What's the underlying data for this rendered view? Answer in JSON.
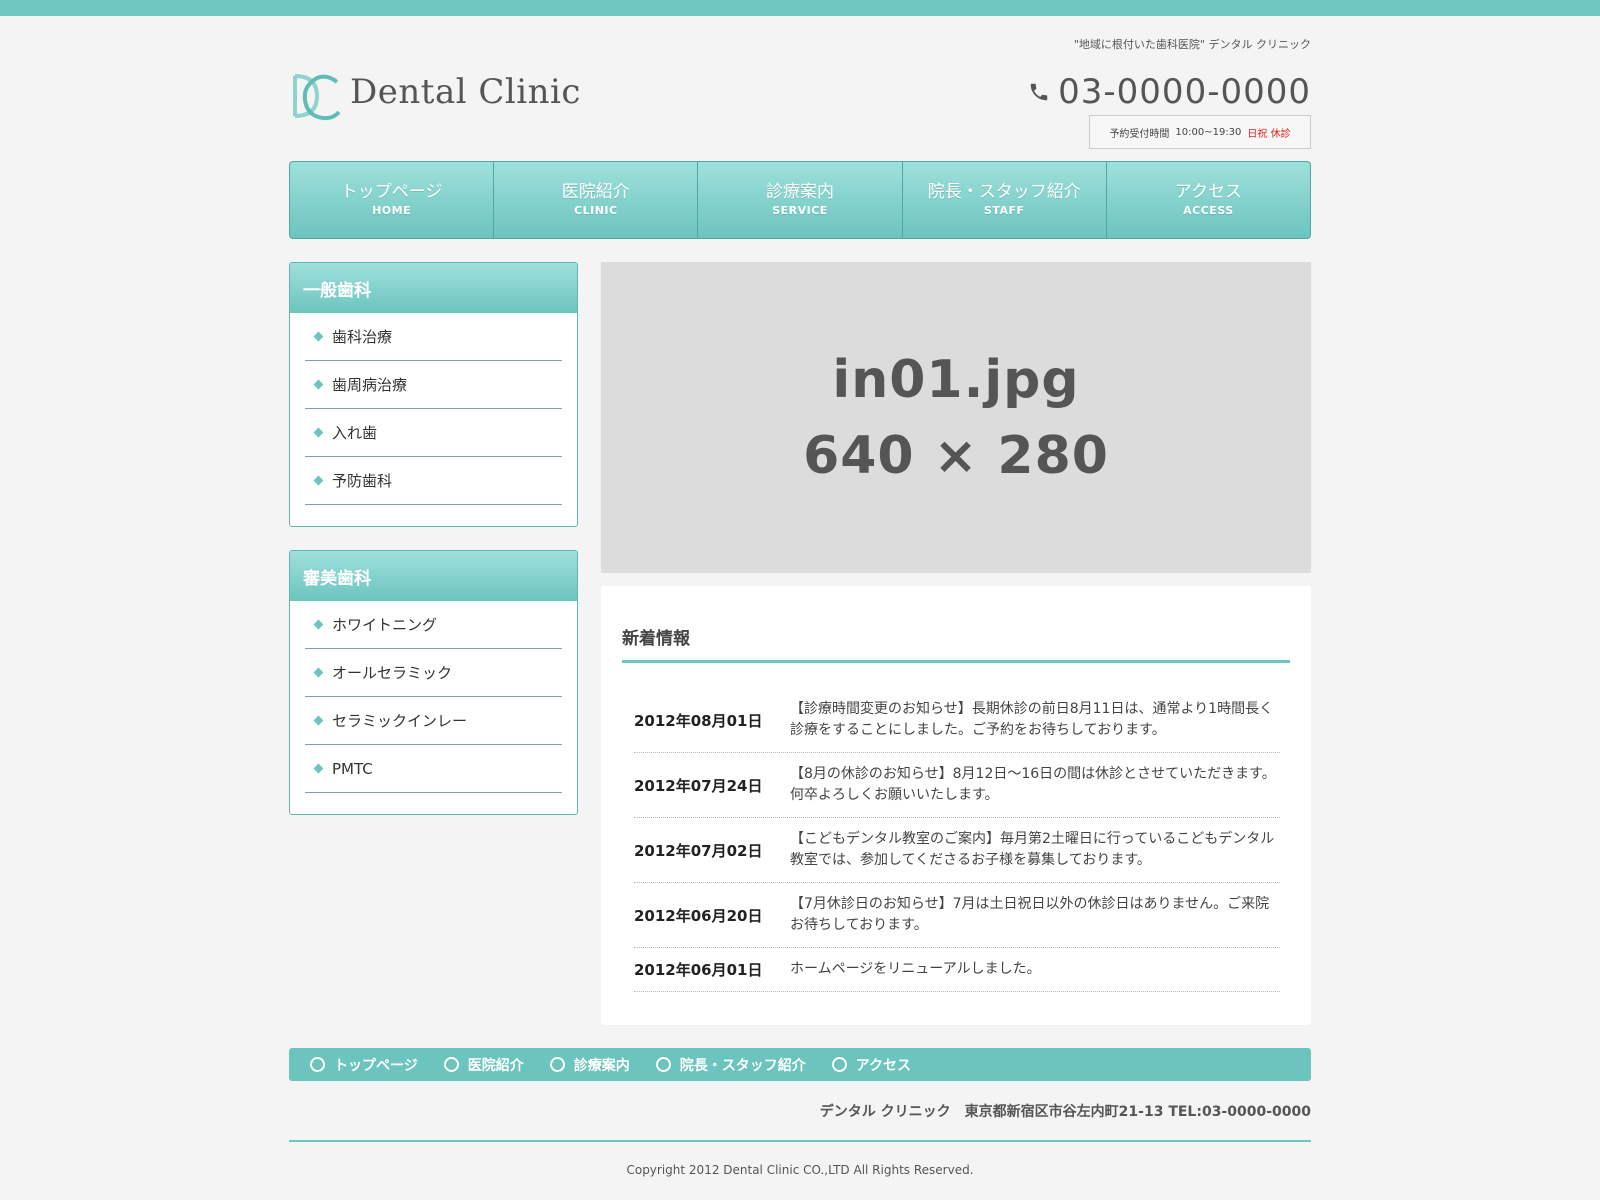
{
  "header": {
    "tagline": "\"地域に根付いた歯科医院\" デンタル クリニック",
    "logo_text": "Dental Clinic",
    "phone": "03-0000-0000",
    "hours_label": "予約受付時間",
    "hours_time": "10:00~19:30",
    "hours_closed": "日祝 休診"
  },
  "nav": [
    {
      "jp": "トップページ",
      "en": "HOME"
    },
    {
      "jp": "医院紹介",
      "en": "CLINIC"
    },
    {
      "jp": "診療案内",
      "en": "SERVICE"
    },
    {
      "jp": "院長・スタッフ紹介",
      "en": "STAFF"
    },
    {
      "jp": "アクセス",
      "en": "ACCESS"
    }
  ],
  "sidebar": {
    "general": {
      "title": "一般歯科",
      "items": [
        "歯科治療",
        "歯周病治療",
        "入れ歯",
        "予防歯科"
      ]
    },
    "cosmetic": {
      "title": "審美歯科",
      "items": [
        "ホワイトニング",
        "オールセラミック",
        "セラミックインレー",
        "PMTC"
      ]
    }
  },
  "hero": {
    "filename": "in01.jpg",
    "size": "640 × 280"
  },
  "news": {
    "title": "新着情報",
    "items": [
      {
        "date": "2012年08月01日",
        "text": "【診療時間変更のお知らせ】長期休診の前日8月11日は、通常より1時間長く診療をすることにしました。ご予約をお待ちしております。"
      },
      {
        "date": "2012年07月24日",
        "text": "【8月の休診のお知らせ】8月12日〜16日の間は休診とさせていただきます。何卒よろしくお願いいたします。"
      },
      {
        "date": "2012年07月02日",
        "text": "【こどもデンタル教室のご案内】毎月第2土曜日に行っているこどもデンタル教室では、参加してくださるお子様を募集しております。"
      },
      {
        "date": "2012年06月20日",
        "text": "【7月休診日のお知らせ】7月は土日祝日以外の休診日はありません。ご来院お待ちしております。"
      },
      {
        "date": "2012年06月01日",
        "text": "ホームページをリニューアルしました。"
      }
    ]
  },
  "footer": {
    "nav": [
      "トップページ",
      "医院紹介",
      "診療案内",
      "院長・スタッフ紹介",
      "アクセス"
    ],
    "address": "デンタル クリニック　東京都新宿区市谷左内町21-13 TEL:03-0000-0000",
    "copyright": "Copyright 2012 Dental Clinic CO.,LTD All Rights Reserved."
  },
  "colors": {
    "accent": "#6fc6c1",
    "closed": "#e02020"
  }
}
